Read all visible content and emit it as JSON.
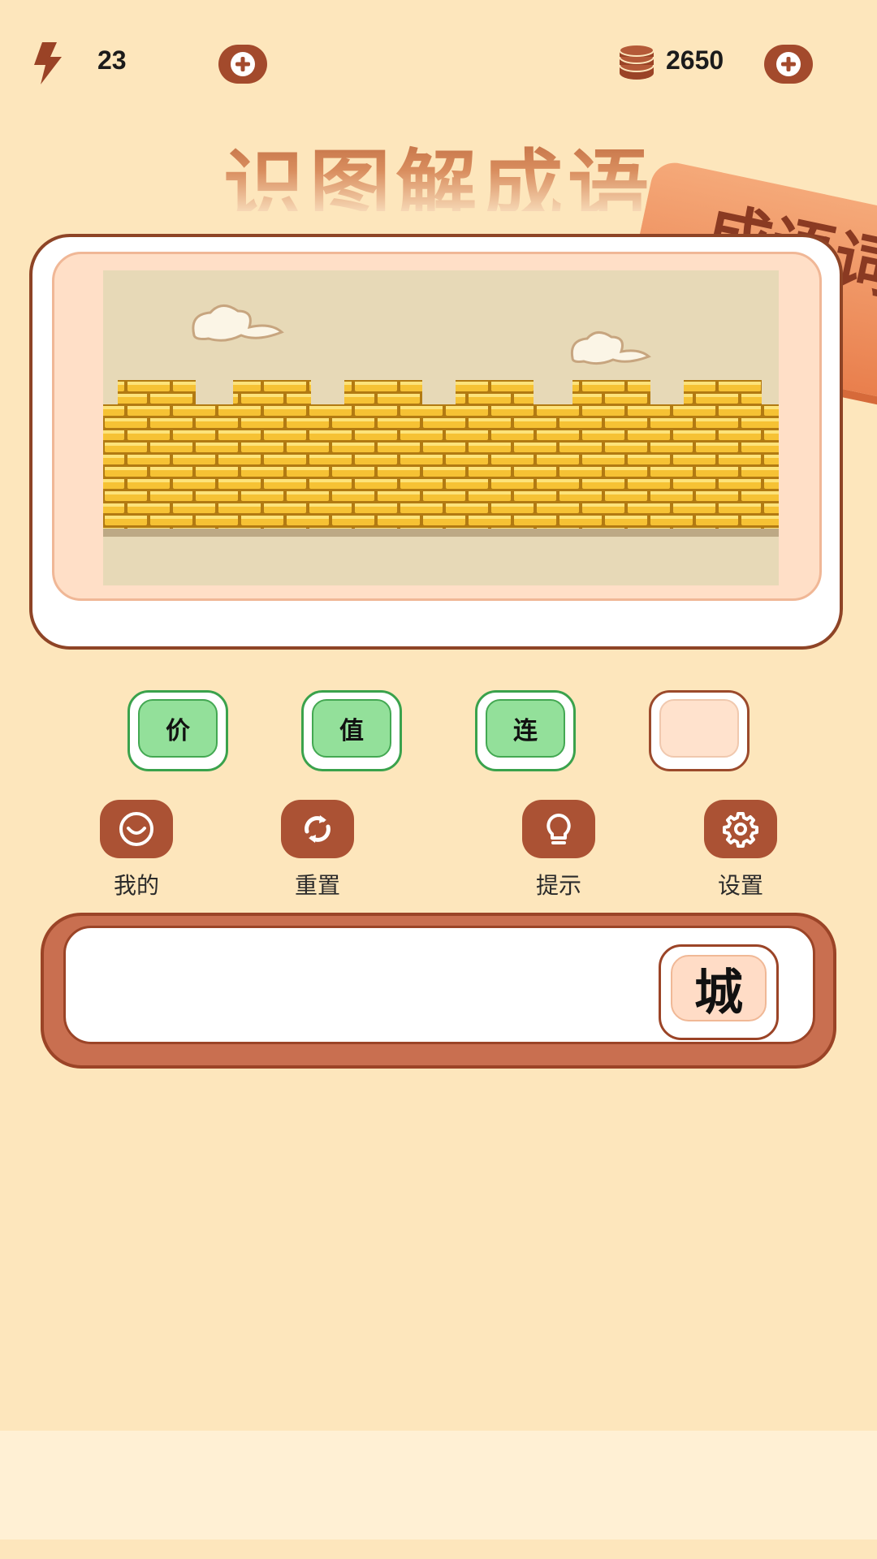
{
  "stats": {
    "energy": "23",
    "coins": "2650"
  },
  "title": "识图解成语",
  "decor_book_text": "成语词",
  "answer_slots": [
    {
      "char": "价",
      "state": "filled"
    },
    {
      "char": "值",
      "state": "filled"
    },
    {
      "char": "连",
      "state": "filled"
    },
    {
      "char": "",
      "state": "empty"
    }
  ],
  "actions": [
    {
      "label": "我的",
      "icon": "smile-icon"
    },
    {
      "label": "重置",
      "icon": "refresh-icon"
    },
    {
      "label": "提示",
      "icon": "lightbulb-icon"
    },
    {
      "label": "设置",
      "icon": "gear-icon"
    }
  ],
  "letter_choices": [
    "城"
  ],
  "colors": {
    "background": "#fde6bc",
    "accent": "#a34a2c",
    "slot_green": "#93e09a",
    "tray": "#c96f50"
  },
  "icons": {
    "energy": "lightning-icon",
    "coins": "coin-stack-icon",
    "add": "plus-icon"
  }
}
